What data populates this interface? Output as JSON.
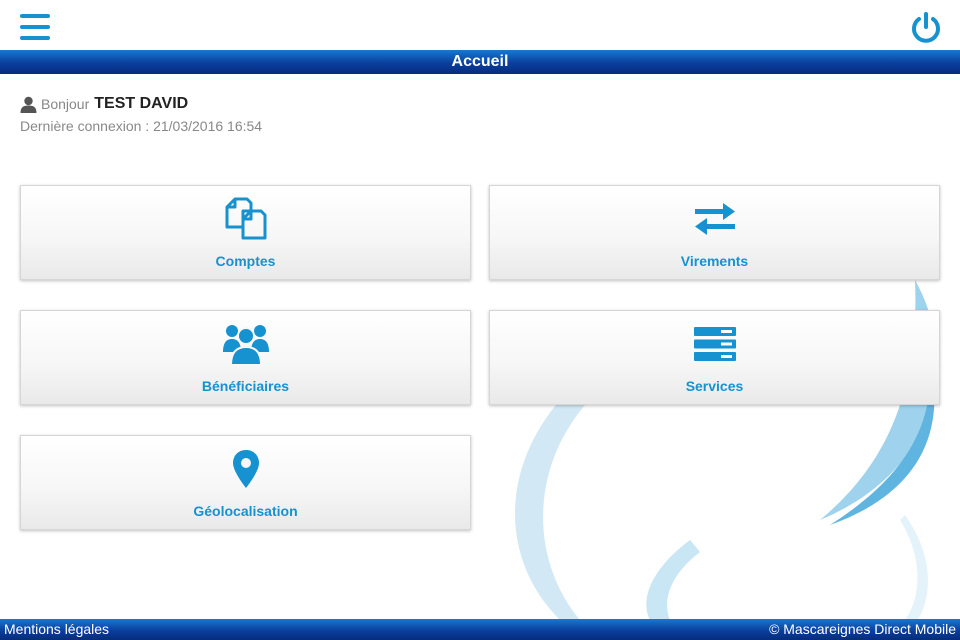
{
  "colors": {
    "accent": "#1592cf",
    "header_blue": "#0a3f9e",
    "text_muted": "#888888"
  },
  "header": {
    "menu_icon": "hamburger-icon",
    "power_icon": "power-icon",
    "title": "Accueil"
  },
  "greeting": {
    "icon": "user-icon",
    "hello": "Bonjour",
    "name": "TEST DAVID",
    "last_login": "Dernière connexion : 21/03/2016 16:54"
  },
  "tiles": [
    {
      "label": "Comptes",
      "icon": "documents-icon"
    },
    {
      "label": "Virements",
      "icon": "transfer-arrows-icon"
    },
    {
      "label": "Bénéficiaires",
      "icon": "users-group-icon"
    },
    {
      "label": "Services",
      "icon": "server-list-icon"
    },
    {
      "label": "Géolocalisation",
      "icon": "map-pin-icon"
    }
  ],
  "footer": {
    "legal": "Mentions légales",
    "copyright": "© Mascareignes Direct Mobile"
  }
}
